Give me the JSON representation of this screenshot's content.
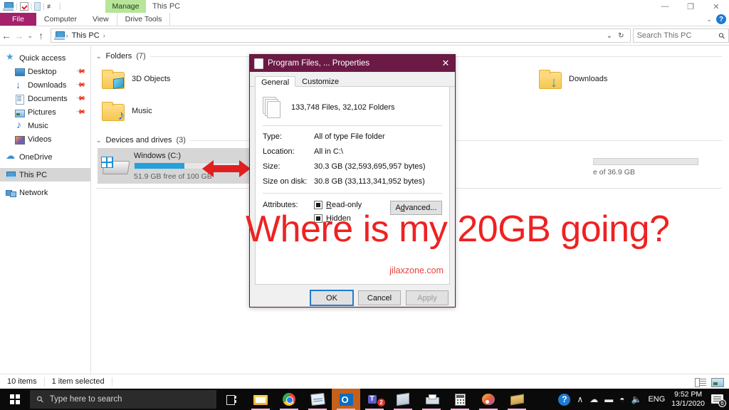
{
  "window": {
    "title": "This PC",
    "quick_access_icons": [
      "this-pc-icon",
      "properties-check-icon",
      "new-folder-icon",
      "customize-dropdown-icon"
    ],
    "contextual_tab": "Manage",
    "minimize": "—",
    "maximize": "❐",
    "close": "✕",
    "ribbon_collapse": "⌄",
    "help": "?"
  },
  "ribbon": {
    "tabs": [
      "File",
      "Computer",
      "View",
      "Drive Tools"
    ]
  },
  "address": {
    "back": "←",
    "forward": "→",
    "recent": "⌄",
    "up": "↑",
    "crumb_icon": "this-pc-icon",
    "crumbs": [
      "This PC"
    ],
    "separator": "›",
    "dropdown": "⌄",
    "refresh": "↻",
    "search_placeholder": "Search This PC",
    "search_value": "",
    "search_icon": "🔍"
  },
  "sidebar": {
    "items": [
      {
        "label": "Quick access",
        "icon": "star-icon",
        "indent": false,
        "pinned": false,
        "selected": false
      },
      {
        "label": "Desktop",
        "icon": "desktop-icon",
        "indent": true,
        "pinned": true,
        "selected": false
      },
      {
        "label": "Downloads",
        "icon": "downloads-icon",
        "indent": true,
        "pinned": true,
        "selected": false
      },
      {
        "label": "Documents",
        "icon": "documents-icon",
        "indent": true,
        "pinned": true,
        "selected": false
      },
      {
        "label": "Pictures",
        "icon": "pictures-icon",
        "indent": true,
        "pinned": true,
        "selected": false
      },
      {
        "label": "Music",
        "icon": "music-icon",
        "indent": true,
        "pinned": false,
        "selected": false
      },
      {
        "label": "Videos",
        "icon": "videos-icon",
        "indent": true,
        "pinned": false,
        "selected": false
      },
      {
        "label": "OneDrive",
        "icon": "cloud-icon",
        "indent": false,
        "pinned": false,
        "selected": false
      },
      {
        "label": "This PC",
        "icon": "this-pc-icon",
        "indent": false,
        "pinned": false,
        "selected": true
      },
      {
        "label": "Network",
        "icon": "network-icon",
        "indent": false,
        "pinned": false,
        "selected": false
      }
    ],
    "pin_glyph": "📌"
  },
  "content": {
    "folders_group": {
      "label": "Folders",
      "count": "(7)",
      "chevron": "⌄"
    },
    "folders": [
      {
        "name": "3D Objects",
        "badge": "cube"
      },
      {
        "name": "Downloads",
        "badge": "download"
      },
      {
        "name": "Music",
        "badge": "note"
      }
    ],
    "drives_group": {
      "label": "Devices and drives",
      "count": "(3)",
      "chevron": "⌄"
    },
    "drives": [
      {
        "name": "Windows  (C:)",
        "free_text": "51.9 GB free of 100 GB",
        "used_percent": 48,
        "selected": true,
        "bar_color": "#26a0da"
      },
      {
        "name": "",
        "free_text": "e of 36.9 GB",
        "used_percent": 0,
        "selected": false,
        "bar_color": "#26a0da"
      }
    ]
  },
  "annotation": {
    "text": "Where is my 20GB going?",
    "color": "#ee2222",
    "arrow_color": "#e02020"
  },
  "dialog": {
    "title": "Program Files, ... Properties",
    "close": "✕",
    "tabs": [
      {
        "label": "General",
        "active": true
      },
      {
        "label": "Customize",
        "active": false
      }
    ],
    "summary": "133,748 Files, 32,102 Folders",
    "properties": [
      {
        "key": "Type:",
        "value": "All of type File folder"
      },
      {
        "key": "Location:",
        "value": "All in C:\\"
      },
      {
        "key": "Size:",
        "value": "30.3 GB (32,593,695,957 bytes)"
      },
      {
        "key": "Size on disk:",
        "value": "30.8 GB (33,113,341,952 bytes)"
      }
    ],
    "attributes_label": "Attributes:",
    "attributes": [
      {
        "label_prefix": "",
        "label_accel": "R",
        "label_rest": "ead-only",
        "state": "mixed"
      },
      {
        "label_prefix": "",
        "label_accel": "H",
        "label_rest": "idden",
        "state": "mixed"
      }
    ],
    "advanced_button": {
      "prefix": "A",
      "accel": "d",
      "rest": "vanced..."
    },
    "watermark": "jilaxzone.com",
    "buttons": [
      {
        "label": "OK",
        "style": "primary"
      },
      {
        "label": "Cancel",
        "style": "normal"
      },
      {
        "label": "Apply",
        "style": "disabled"
      }
    ]
  },
  "statusbar": {
    "item_count": "10 items",
    "selection": "1 item selected",
    "view_details_icon": "details-view-icon",
    "view_thumbs_icon": "thumbnail-view-icon"
  },
  "taskbar": {
    "start": "windows-logo",
    "search_placeholder": "Type here to search",
    "task_view": "task-view-icon",
    "apps": [
      {
        "name": "file-explorer",
        "active": false,
        "badge": ""
      },
      {
        "name": "google-chrome",
        "active": false,
        "badge": ""
      },
      {
        "name": "task-manager",
        "active": false,
        "badge": ""
      },
      {
        "name": "outlook",
        "active": true,
        "badge": ""
      },
      {
        "name": "microsoft-teams",
        "active": false,
        "badge": "2"
      },
      {
        "name": "reader",
        "active": false,
        "badge": ""
      },
      {
        "name": "printer",
        "active": false,
        "badge": ""
      },
      {
        "name": "calculator",
        "active": false,
        "badge": ""
      },
      {
        "name": "paint",
        "active": false,
        "badge": ""
      },
      {
        "name": "sticky-notes",
        "active": false,
        "badge": ""
      }
    ],
    "tray": {
      "help": "?",
      "chevron": "∧",
      "onedrive": "☁",
      "battery": "▬",
      "network": "📶",
      "volume": "🔊",
      "language": "ENG",
      "time": "9:52 PM",
      "date": "13/1/2020",
      "notification_count": "6"
    }
  }
}
